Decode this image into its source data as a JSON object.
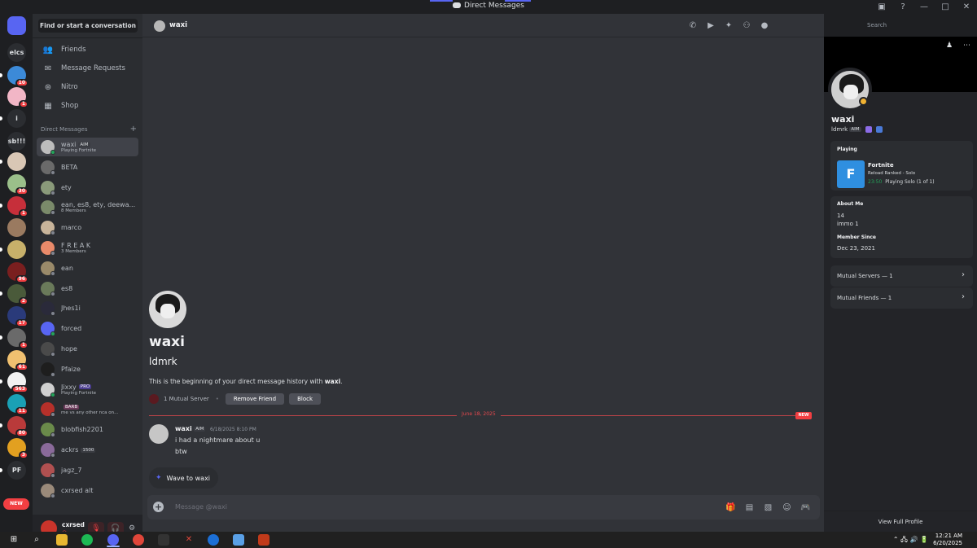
{
  "window": {
    "title": "Direct Messages"
  },
  "rail": {
    "servers": [
      {
        "label": "",
        "color": "#5865f2",
        "badge": "",
        "icon": "discord-home-icon"
      },
      {
        "label": "elcs",
        "color": "",
        "badge": "",
        "icon": ""
      },
      {
        "label": "",
        "color": "#3c8ad8",
        "badge": "10",
        "icon": ""
      },
      {
        "label": "",
        "color": "#f2b6c6",
        "badge": "1",
        "icon": ""
      },
      {
        "label": "i",
        "color": "",
        "badge": "",
        "icon": ""
      },
      {
        "label": "sb!!!",
        "color": "",
        "badge": "",
        "icon": ""
      },
      {
        "label": "",
        "color": "#d9c7b5",
        "badge": "",
        "icon": ""
      },
      {
        "label": "",
        "color": "#9bbf8a",
        "badge": "30",
        "icon": ""
      },
      {
        "label": "",
        "color": "#c62f3a",
        "badge": "1",
        "icon": ""
      },
      {
        "label": "",
        "color": "#9a7a60",
        "badge": "",
        "icon": ""
      },
      {
        "label": "",
        "color": "#c7b06a",
        "badge": "",
        "icon": ""
      },
      {
        "label": "",
        "color": "#7a1f1f",
        "badge": "96",
        "icon": ""
      },
      {
        "label": "",
        "color": "#4a5a3a",
        "badge": "2",
        "icon": ""
      },
      {
        "label": "",
        "color": "#2a3a7a",
        "badge": "17",
        "icon": ""
      },
      {
        "label": "",
        "color": "#6a6a6a",
        "badge": "1",
        "icon": ""
      },
      {
        "label": "",
        "color": "#f0c070",
        "badge": "61",
        "icon": ""
      },
      {
        "label": "",
        "color": "#f2f2f2",
        "badge": "563",
        "icon": ""
      },
      {
        "label": "",
        "color": "#1aa0b5",
        "badge": "11",
        "icon": ""
      },
      {
        "label": "",
        "color": "#b93a3a",
        "badge": "80",
        "icon": ""
      },
      {
        "label": "",
        "color": "#e2a020",
        "badge": "3",
        "icon": ""
      },
      {
        "label": "PF",
        "color": "",
        "badge": "",
        "icon": ""
      }
    ],
    "new_label": "NEW"
  },
  "sidebar": {
    "search_label": "Find or start a conversation",
    "nav": [
      {
        "label": "Friends",
        "icon": "friends-icon"
      },
      {
        "label": "Message Requests",
        "icon": "mail-icon"
      },
      {
        "label": "Nitro",
        "icon": "nitro-icon"
      },
      {
        "label": "Shop",
        "icon": "shop-icon"
      }
    ],
    "dm_header": "Direct Messages",
    "dms": [
      {
        "name": "waxi",
        "tag": "AIM",
        "sub": "Playing Fortnite",
        "color": "#bdbdbd",
        "online": true
      },
      {
        "name": "BETA",
        "tag": "",
        "sub": "",
        "color": "#6a6a6a",
        "online": false
      },
      {
        "name": "ety",
        "tag": "",
        "sub": "",
        "color": "#8a9a7a",
        "online": false
      },
      {
        "name": "ean, es8, ety, deewa...",
        "tag": "",
        "sub": "8 Members",
        "color": "#7a8a6a",
        "online": false
      },
      {
        "name": "marco",
        "tag": "",
        "sub": "",
        "color": "#c8b49a",
        "online": false
      },
      {
        "name": "F R E A K",
        "tag": "",
        "sub": "3 Members",
        "color": "#e98a6a",
        "online": false
      },
      {
        "name": "ean",
        "tag": "",
        "sub": "",
        "color": "#9a8a6a",
        "online": false
      },
      {
        "name": "es8",
        "tag": "",
        "sub": "",
        "color": "#6a7a5a",
        "online": false
      },
      {
        "name": "Jhes1i",
        "tag": "",
        "sub": "",
        "color": "#2a2a3a",
        "online": false
      },
      {
        "name": "forced",
        "tag": "",
        "sub": "",
        "color": "#5865f2",
        "online": true
      },
      {
        "name": "hope",
        "tag": "",
        "sub": "",
        "color": "#4a4a4a",
        "online": false
      },
      {
        "name": "Pfaize",
        "tag": "",
        "sub": "",
        "color": "#1e1e1e",
        "online": false
      },
      {
        "name": "Jixxy",
        "tag": "PRO",
        "sub": "Playing Fortnite",
        "color": "#d0d0d0",
        "online": true
      },
      {
        "name": "",
        "tag": "BARB",
        "sub": "me vs any other nca on...",
        "color": "#b5302a",
        "online": false
      },
      {
        "name": "blobfish2201",
        "tag": "",
        "sub": "",
        "color": "#6a8a4a",
        "online": false
      },
      {
        "name": "ackrs",
        "tag": "1500",
        "sub": "",
        "color": "#8a6a9a",
        "online": false
      },
      {
        "name": "jagz_7",
        "tag": "",
        "sub": "",
        "color": "#b05050",
        "online": false
      },
      {
        "name": "cxrsed alt",
        "tag": "",
        "sub": "",
        "color": "#9a8a7a",
        "online": false
      }
    ]
  },
  "user_panel": {
    "name": "cxrsed",
    "status": "◎"
  },
  "header": {
    "name": "waxi",
    "search_placeholder": "Search"
  },
  "intro": {
    "name": "waxi",
    "username": "ldmrk",
    "text_prefix": "This is the beginning of your direct message history with ",
    "text_name": "waxi",
    "text_suffix": ".",
    "mutual_servers": "1 Mutual Server",
    "remove_friend": "Remove Friend",
    "block": "Block"
  },
  "divider": {
    "date": "June 18, 2025",
    "new_label": "NEW"
  },
  "message": {
    "author": "waxi",
    "tag": "AIM",
    "timestamp": "6/18/2025 8:10 PM",
    "lines": [
      "i had a nightmare about u",
      "btw"
    ]
  },
  "wave": {
    "label": "Wave to waxi"
  },
  "composer": {
    "placeholder": "Message @waxi"
  },
  "profile": {
    "name": "waxi",
    "username": "ldmrk",
    "tag": "AIM",
    "activity_label": "Playing",
    "game": "Fortnite",
    "game_detail": "Reload Ranked - Solo",
    "game_time": "23:50",
    "game_party": "Playing Solo (1 of 1)",
    "about_label": "About Me",
    "about_lines": [
      "14",
      "immo 1"
    ],
    "member_since_label": "Member Since",
    "member_since": "Dec 23, 2021",
    "mutual_servers": "Mutual Servers — 1",
    "mutual_friends": "Mutual Friends — 1",
    "view_full": "View Full Profile"
  },
  "taskbar": {
    "time": "12:21 AM",
    "date": "6/20/2025"
  }
}
